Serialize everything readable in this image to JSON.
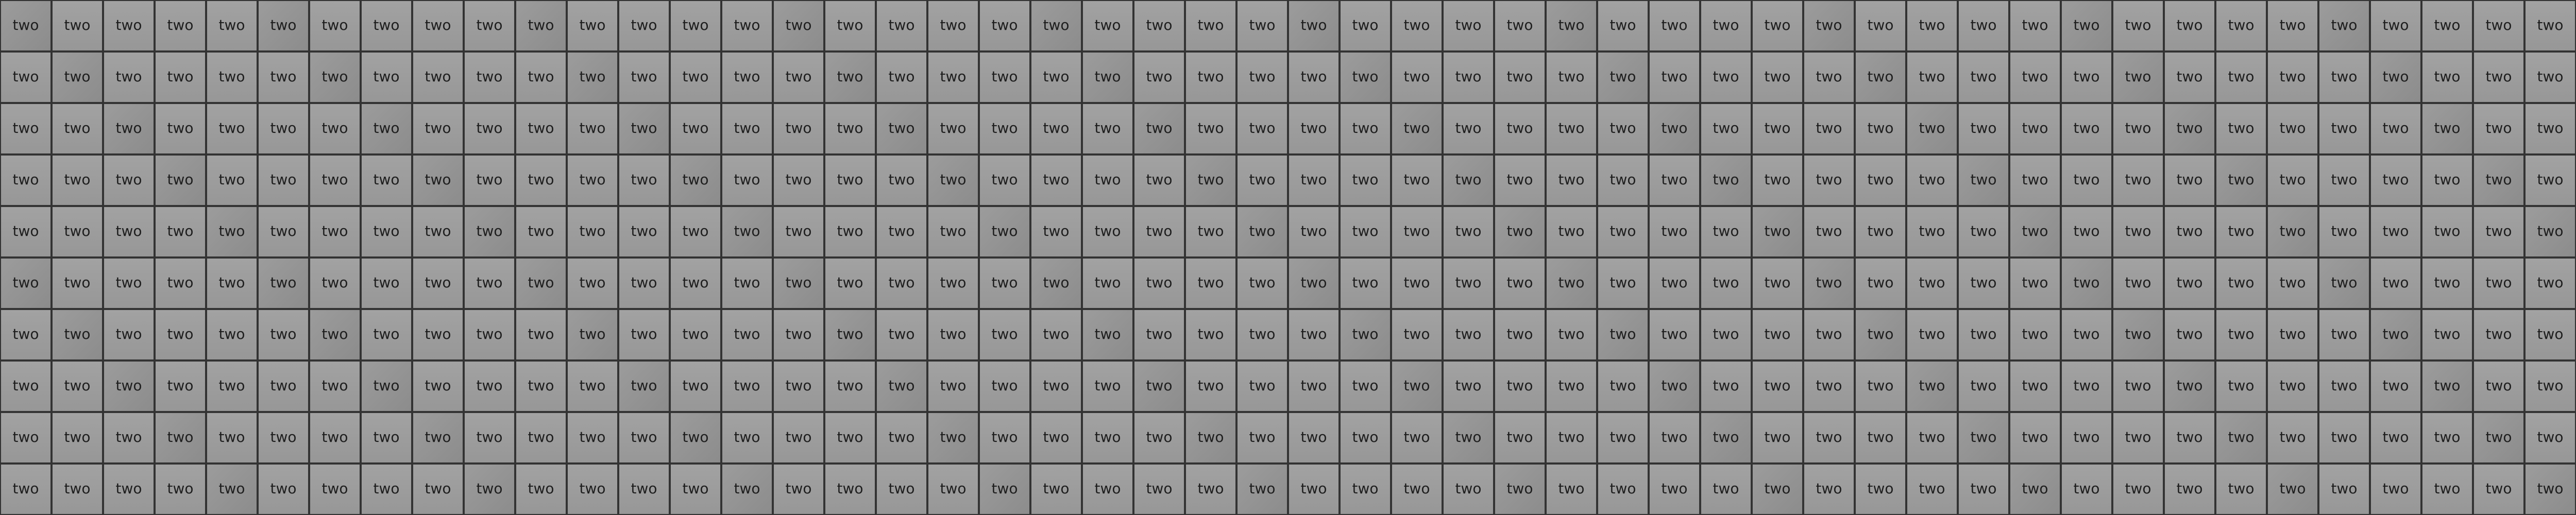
{
  "grid": {
    "rows": 10,
    "columns": 50
  },
  "tile": {
    "label": "two"
  },
  "colors": {
    "tile": "#9c9c9c",
    "border": "#333333",
    "text": "#1e1e1e"
  }
}
